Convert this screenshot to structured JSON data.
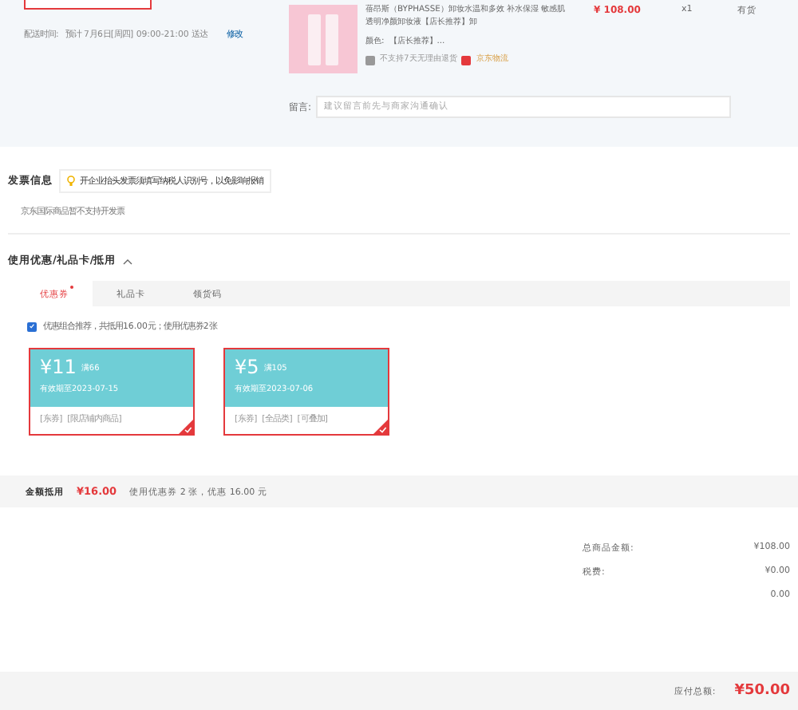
{
  "delivery": {
    "label": "配送时间:",
    "value": "预计 7月6日[周四] 09:00-21:00 送达",
    "action": "修改"
  },
  "product": {
    "title": "蓓昂斯（BYPHASSE）卸妆水温和多效 补水保湿 敏感肌透明净颜卸妆液【店长推荐】卸",
    "price": "¥ 108.00",
    "quantity": "x1",
    "stock": "有货",
    "variant_label": "颜色:",
    "variant_value": "【店长推荐】...",
    "return_policy": "不支持7天无理由退货",
    "logistics": "京东物流"
  },
  "message": {
    "label": "留言:",
    "placeholder": "建议留言前先与商家沟通确认"
  },
  "invoice": {
    "title": "发票信息",
    "tip": "开企业抬头发票须填写纳税人识别号，以免影响报销",
    "note": "京东国际商品暂不支持开发票"
  },
  "discounts": {
    "title": "使用优惠/礼品卡/抵用",
    "expanded": true,
    "tabs": [
      {
        "label": "优惠券",
        "selected": true,
        "dot": true
      },
      {
        "label": "礼品卡",
        "selected": false,
        "dot": false
      },
      {
        "label": "领货码",
        "selected": false,
        "dot": false
      }
    ],
    "combo": {
      "checked": true,
      "text": "优惠组合推荐，共抵用16.00元；使用优惠券2张"
    },
    "coupons": [
      {
        "amount": "¥11",
        "condition": "满66",
        "validity": "有效期至2023-07-15",
        "tags": [
          "[东券]",
          "[限店铺内商品]"
        ],
        "selected": true
      },
      {
        "amount": "¥5",
        "condition": "满105",
        "validity": "有效期至2023-07-06",
        "tags": [
          "[东券]",
          "[全品类]",
          "[可叠加]"
        ],
        "selected": true
      }
    ],
    "summary": {
      "label": "金额抵用",
      "amount": "¥16.00",
      "text": "使用优惠券 2 张，优惠 16.00 元"
    }
  },
  "totals": [
    {
      "label": "总商品金额:",
      "value": "¥108.00"
    },
    {
      "label": "税费:",
      "value": "¥0.00"
    },
    {
      "value": "0.00"
    }
  ],
  "payable": {
    "label": "应付总额:",
    "value": "¥50.00"
  }
}
